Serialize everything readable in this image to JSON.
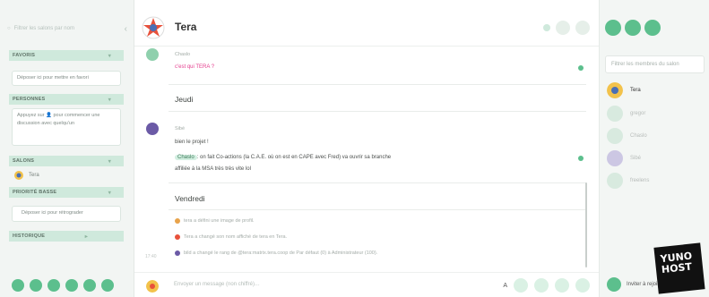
{
  "sidebar": {
    "filter_placeholder": "Filtrer les salons par nom",
    "sections": {
      "favoris": "FAVORIS",
      "personnes": "PERSONNES",
      "salons": "SALONS",
      "priorite_basse": "PRIORITÉ BASSE",
      "historique": "HISTORIQUE"
    },
    "favoris_hint": "Déposer ici pour mettre en favori",
    "personnes_hint": "Appuyez sur 👤 pour commencer une discussion avec quelqu'un",
    "low_priority_hint": "Déposer ici pour rétrograder",
    "room": "Tera"
  },
  "header": {
    "title": "Tera"
  },
  "timeline": {
    "msg1_sender": "Chaslo",
    "msg1_text": "c'est qui TERA ?",
    "day1": "Jeudi",
    "msg2_sender": "Sibé",
    "msg2_text1": "bien le projet !",
    "msg2_pill": "Chaslo",
    "msg2_text2": ": on fait Co-actions (la C.A.E. où on est en CAPE avec Fred) va ouvrir sa branche",
    "msg2_text3": "affiliée à la MSA très très vite lol",
    "day2": "Vendredi",
    "notice1": "tera a défini une image de profil.",
    "notice2": "Tera a changé son nom affiché de tera en Tera.",
    "notice3": "bild a changé le rang de @tera:matrix.tera.coop de Par défaut (0) à Administrateur (100).",
    "time": "17:40"
  },
  "composer": {
    "placeholder": "Envoyer un message (non chiffré)…"
  },
  "right_panel": {
    "filter_placeholder": "Filtrer les membres du salon",
    "members": [
      "Tera",
      "gregor",
      "Chaslo",
      "Sibé",
      "freelens"
    ],
    "invite": "Inviter à rejoindre"
  },
  "logo_text": "YUNO HOST",
  "colors": {
    "accent": "#5cbf8d",
    "mention": "#e43c8d"
  }
}
